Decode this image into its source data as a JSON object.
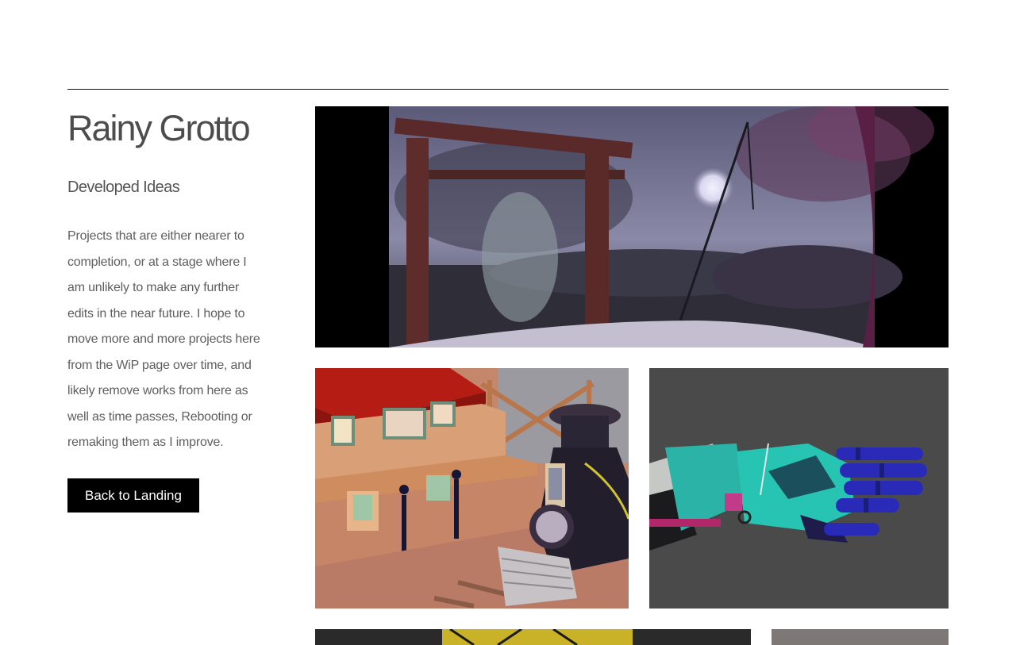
{
  "sidebar": {
    "title": "Rainy Grotto",
    "section_heading": "Developed Ideas",
    "description": "Projects that are either nearer to completion, or at a stage where I am unlikely to make any further edits in the near future. I hope to move more and more projects here from the WiP page over time, and likely remove works from here as well as time passes, Rebooting or remaking them as I improve.",
    "back_button_label": "Back to Landing"
  },
  "colors": {
    "background": "#ffffff",
    "text": "#555555",
    "button_bg": "#000000",
    "button_text": "#ffffff",
    "rule": "#111111"
  }
}
